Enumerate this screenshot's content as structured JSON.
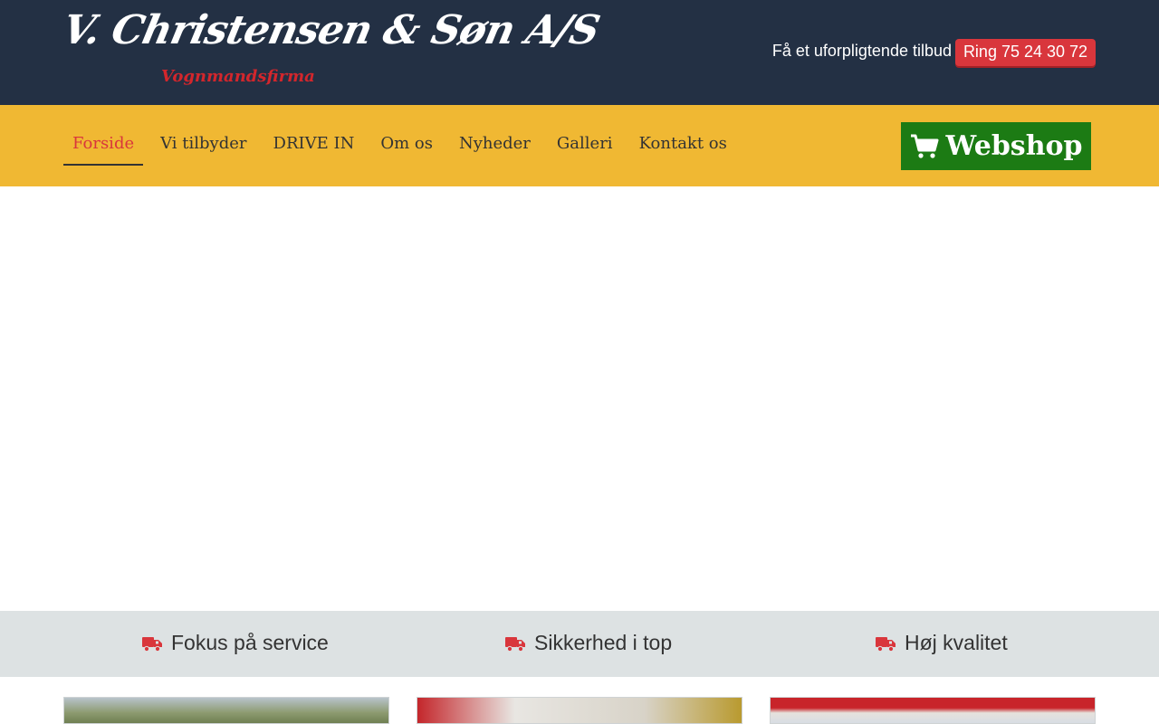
{
  "header": {
    "logo_title": "V. Christensen & Søn A/S",
    "logo_subtitle": "Vognmandsfirma",
    "tagline": "Få et uforpligtende tilbud",
    "call_button": "Ring 75 24 30 72"
  },
  "nav": {
    "items": [
      {
        "label": "Forside",
        "active": true
      },
      {
        "label": "Vi tilbyder",
        "active": false
      },
      {
        "label": "DRIVE IN",
        "active": false
      },
      {
        "label": "Om os",
        "active": false
      },
      {
        "label": "Nyheder",
        "active": false
      },
      {
        "label": "Galleri",
        "active": false
      },
      {
        "label": "Kontakt os",
        "active": false
      }
    ],
    "webshop_label": "Webshop",
    "webshop_icon": "shopping-cart-icon"
  },
  "features": [
    {
      "label": "Fokus på service",
      "icon": "truck-icon"
    },
    {
      "label": "Sikkerhed i top",
      "icon": "truck-icon"
    },
    {
      "label": "Høj kvalitet",
      "icon": "truck-icon"
    }
  ],
  "colors": {
    "header_bg": "#233044",
    "nav_bg": "#f0b833",
    "accent_red": "#d9363c",
    "webshop_green": "#1c7b14",
    "feature_bar_bg": "#dde2e3"
  }
}
